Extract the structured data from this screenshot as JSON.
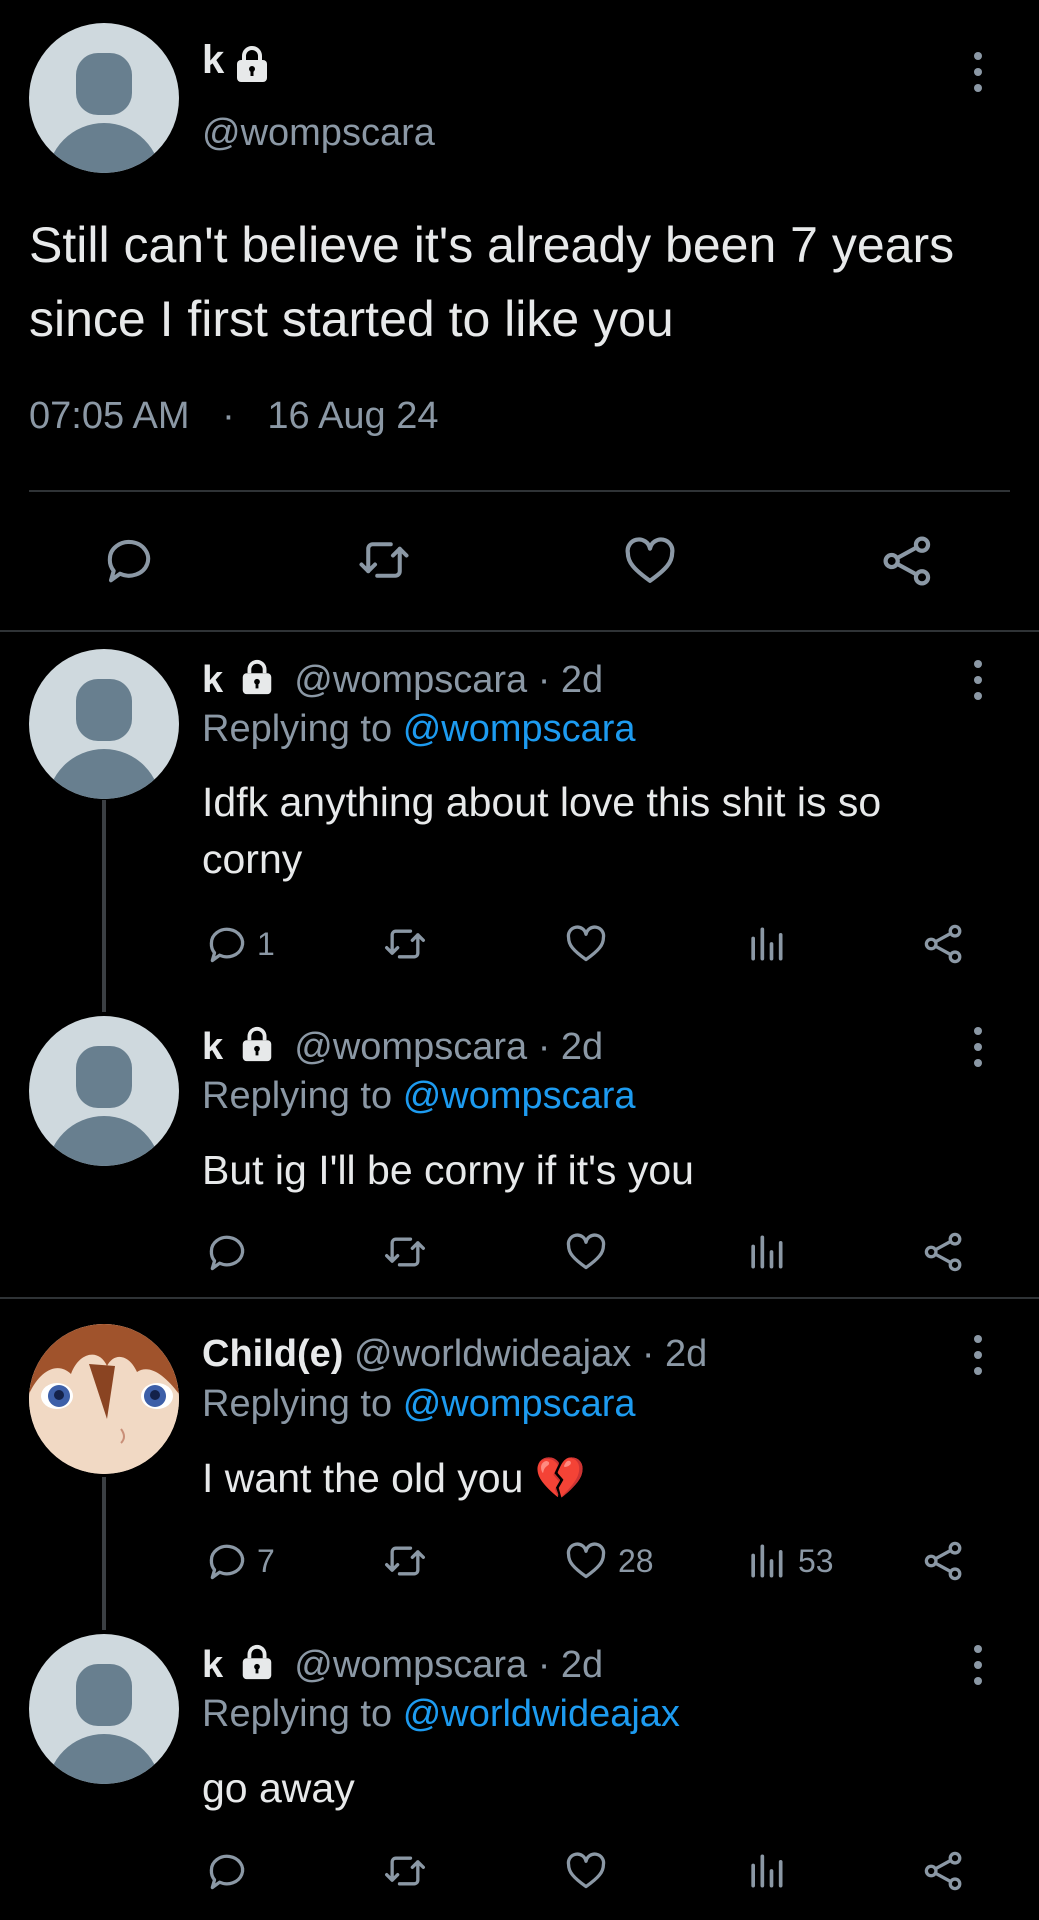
{
  "main_tweet": {
    "display_name": "k",
    "handle": "@wompscara",
    "text_line1": "Still can't believe it's already been 7 years",
    "text_line2": "since I first started to like you",
    "time": "07:05 AM",
    "separator": "·",
    "date": "16 Aug 24"
  },
  "replies": [
    {
      "display_name": "k",
      "handle": "@wompscara",
      "age": "· 2d",
      "replying_label": "Replying to",
      "replying_to": "@wompscara",
      "text_line1": "Idfk anything about love this shit is so",
      "text_line2": "corny",
      "reply_count": "1",
      "like_count": "",
      "view_count": ""
    },
    {
      "display_name": "k",
      "handle": "@wompscara",
      "age": "· 2d",
      "replying_label": "Replying to",
      "replying_to": "@wompscara",
      "text_line1": "But ig I'll be corny if it's you",
      "reply_count": "",
      "like_count": "",
      "view_count": ""
    },
    {
      "display_name": "Child(e)",
      "handle": "@worldwideajax",
      "age": "· 2d",
      "replying_label": "Replying to",
      "replying_to": "@wompscara",
      "text_line1": "I want the old you 💔",
      "reply_count": "7",
      "like_count": "28",
      "view_count": "53"
    },
    {
      "display_name": "k",
      "handle": "@wompscara",
      "age": "· 2d",
      "replying_label": "Replying to",
      "replying_to": "@worldwideajax",
      "text_line1": "go away",
      "reply_count": "",
      "like_count": "",
      "view_count": ""
    }
  ],
  "colors": {
    "background": "#000000",
    "text": "#e7e9ea",
    "muted": "#8b98a5",
    "link": "#1d9bf0",
    "divider": "#2f3336"
  }
}
